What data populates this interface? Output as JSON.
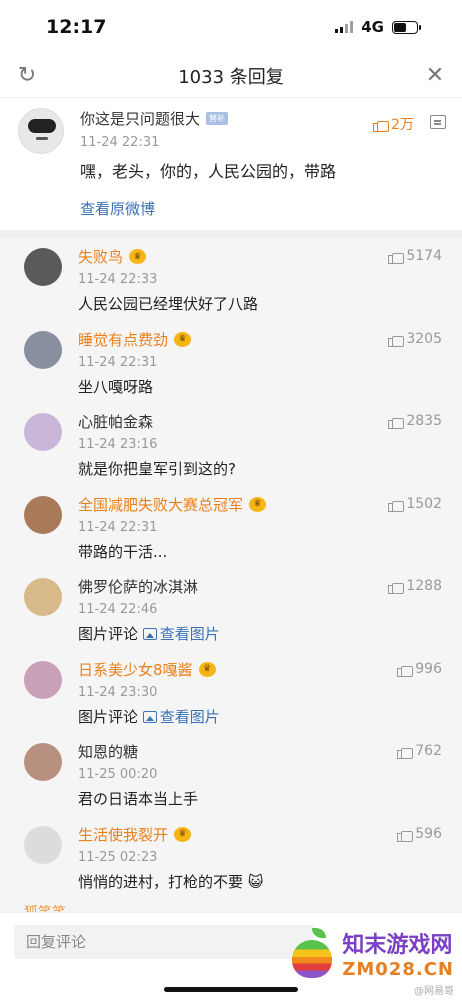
{
  "status_bar": {
    "time": "12:17",
    "network": "4G",
    "battery_level": 0.55
  },
  "header": {
    "title": "1033 条回复",
    "refresh_icon": "refresh-icon",
    "close_icon": "close-icon"
  },
  "main_post": {
    "name": "你这是只问题很大",
    "badge": "替补",
    "date": "11-24 22:31",
    "content": "嘿，老头，你的，人民公园的，带路",
    "likes": "2万",
    "view_link": "查看原微博"
  },
  "replies": [
    {
      "name": "失败鸟",
      "orange": true,
      "crown": true,
      "date": "11-24 22:33",
      "content": "人民公园已经埋伏好了八路",
      "likes": "5174",
      "avatar": "#5a5a5a"
    },
    {
      "name": "睡觉有点费劲",
      "orange": true,
      "crown": true,
      "date": "11-24 22:31",
      "content": "坐八嘎呀路",
      "likes": "3205",
      "avatar": "#8a8fa0"
    },
    {
      "name": "心脏帕金森",
      "orange": false,
      "crown": false,
      "date": "11-24 23:16",
      "content": "就是你把皇军引到这的?",
      "likes": "2835",
      "avatar": "#c9b6d8"
    },
    {
      "name": "全国减肥失败大赛总冠军",
      "orange": true,
      "crown": true,
      "date": "11-24 22:31",
      "content": "带路的干活...",
      "likes": "1502",
      "avatar": "#a87a5a"
    },
    {
      "name": "佛罗伦萨的冰淇淋",
      "orange": false,
      "crown": false,
      "date": "11-24 22:46",
      "content": "图片评论",
      "img_link": "查看图片",
      "likes": "1288",
      "avatar": "#d8b98a"
    },
    {
      "name": "日系美少女8嘎酱",
      "orange": true,
      "crown": true,
      "date": "11-24 23:30",
      "content": "图片评论",
      "img_link": "查看图片",
      "likes": "996",
      "avatar": "#c8a0b8"
    },
    {
      "name": "知恩的糖",
      "orange": false,
      "crown": false,
      "date": "11-25 00:20",
      "content": "君の日语本当上手",
      "likes": "762",
      "avatar": "#b89080"
    },
    {
      "name": "生活使我裂开",
      "orange": true,
      "crown": true,
      "date": "11-25 02:23",
      "content": "悄悄的进村，打枪的不要",
      "emoji": "😺",
      "likes": "596",
      "avatar": "#dcdcdc"
    }
  ],
  "partial_reply": "狐笑笑",
  "footer": {
    "reply_placeholder": "回复评论"
  },
  "watermark": {
    "cn": "知末游戏网",
    "en": "ZM028.CN",
    "small": "@网易哥"
  }
}
